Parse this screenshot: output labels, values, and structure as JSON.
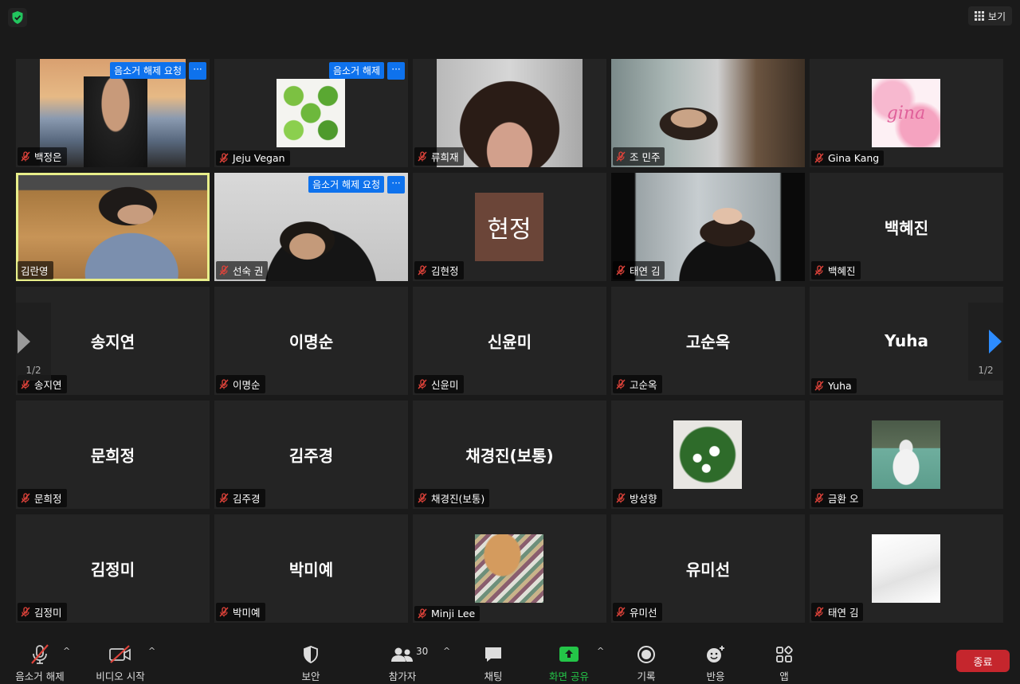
{
  "topbar": {
    "view_label": "보기"
  },
  "tile_actions": {
    "unmute_request": "음소거 해제 요청",
    "unmute": "음소거 해제",
    "more": "···"
  },
  "pagination": {
    "left_page": "1/2",
    "right_page": "1/2"
  },
  "tiles": [
    {
      "name": "백정은"
    },
    {
      "name": "Jeju Vegan"
    },
    {
      "name": "류희재"
    },
    {
      "name": "조 민주"
    },
    {
      "name": "Gina Kang",
      "avatar_text": "gina"
    },
    {
      "name": "김란영"
    },
    {
      "name": "선숙 권"
    },
    {
      "name": "김현정",
      "avatar_text": "현정"
    },
    {
      "name": "태연 김"
    },
    {
      "name": "백혜진",
      "display": "백혜진"
    },
    {
      "name": "송지연",
      "display": "송지연"
    },
    {
      "name": "이명순",
      "display": "이명순"
    },
    {
      "name": "신윤미",
      "display": "신윤미"
    },
    {
      "name": "고순옥",
      "display": "고순옥"
    },
    {
      "name": "Yuha",
      "display": "Yuha"
    },
    {
      "name": "문희정",
      "display": "문희정"
    },
    {
      "name": "김주경",
      "display": "김주경"
    },
    {
      "name": "채경진(보통)",
      "display": "채경진(보통)"
    },
    {
      "name": "방성향"
    },
    {
      "name": "금환 오"
    },
    {
      "name": "김정미",
      "display": "김정미"
    },
    {
      "name": "박미예",
      "display": "박미예"
    },
    {
      "name": "Minji Lee"
    },
    {
      "name": "유미선",
      "display": "유미선"
    },
    {
      "name": "태연 김"
    }
  ],
  "toolbar": {
    "unmute": "음소거 해제",
    "start_video": "비디오 시작",
    "security": "보안",
    "participants": "참가자",
    "participants_count": "30",
    "chat": "채팅",
    "share_screen": "화면 공유",
    "record": "기록",
    "reactions": "반응",
    "apps": "앱",
    "end": "종료",
    "caret": "^"
  },
  "colors": {
    "accent_blue": "#0e72ed",
    "share_green": "#24c548",
    "end_red": "#c5262d",
    "active_speaker": "#e8ee8a",
    "mute_red": "#e0433a"
  }
}
